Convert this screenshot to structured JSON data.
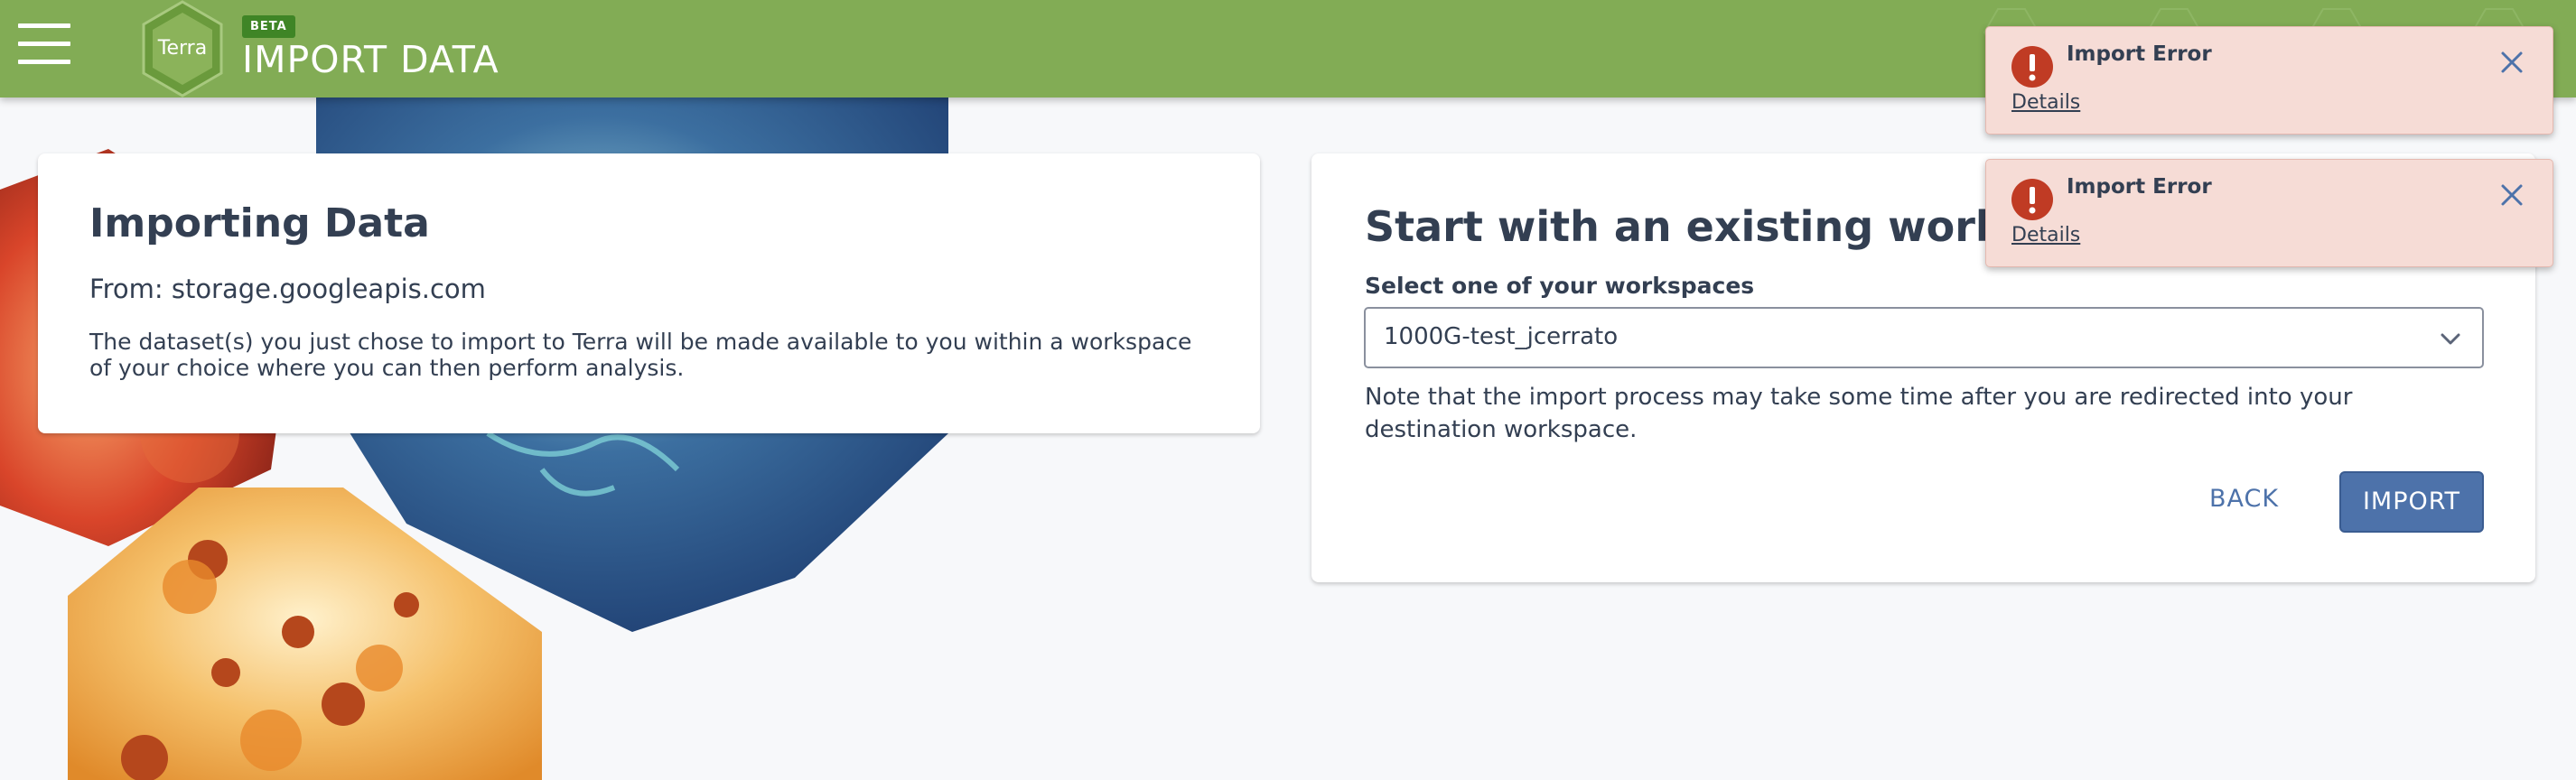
{
  "header": {
    "badge": "BETA",
    "title": "IMPORT DATA",
    "logo_text": "Terra"
  },
  "import_card": {
    "title": "Importing Data",
    "from": "From: storage.googleapis.com",
    "description": "The dataset(s) you just chose to import to Terra will be made available to you within a workspace of your choice where you can then perform analysis."
  },
  "workspace_card": {
    "title": "Start with an existing workspace",
    "select_label": "Select one of your workspaces",
    "selected_workspace": "1000G-test_jcerrato",
    "note": "Note that the import process may take some time after you are redirected into your destination workspace.",
    "back_label": "BACK",
    "import_label": "IMPORT"
  },
  "toasts": [
    {
      "title": "Import Error",
      "link": "Details"
    },
    {
      "title": "Import Error",
      "link": "Details"
    }
  ],
  "colors": {
    "header_green": "#82ac55",
    "primary_blue": "#4d72aa",
    "error_red": "#c03b24",
    "toast_bg": "#f6dcd6"
  },
  "icons": [
    "hamburger-menu-icon",
    "terra-logo",
    "error-icon",
    "close-icon",
    "chevron-down-icon"
  ]
}
